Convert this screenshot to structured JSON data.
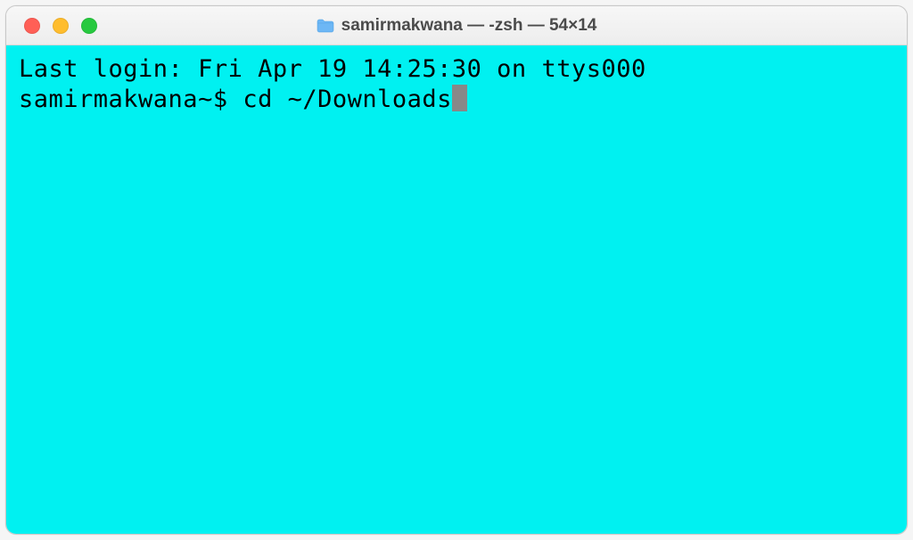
{
  "window": {
    "title": "samirmakwana — -zsh — 54×14"
  },
  "terminal": {
    "last_login_line": "Last login: Fri Apr 19 14:25:30 on ttys000",
    "prompt": "samirmakwana~$ ",
    "command": "cd ~/Downloads",
    "background_color": "#00f1f1"
  }
}
